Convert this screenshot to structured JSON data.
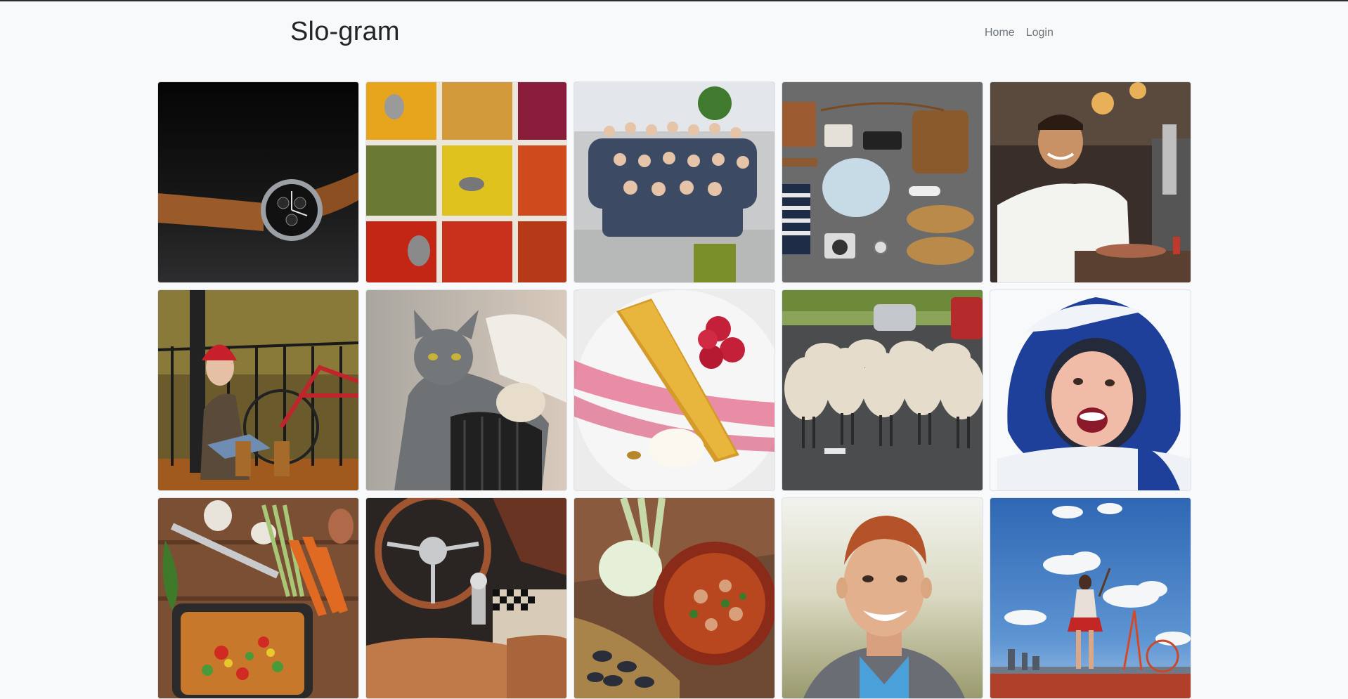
{
  "header": {
    "brand": "Slo-gram",
    "nav": [
      {
        "label": "Home"
      },
      {
        "label": "Login"
      }
    ]
  },
  "photos": [
    {
      "subject": "wristwatch"
    },
    {
      "subject": "spices"
    },
    {
      "subject": "group-photo"
    },
    {
      "subject": "flatlay-accessories"
    },
    {
      "subject": "chef"
    },
    {
      "subject": "woman-with-bicycle"
    },
    {
      "subject": "gray-cat"
    },
    {
      "subject": "tart-dessert"
    },
    {
      "subject": "sheep-on-road"
    },
    {
      "subject": "child-in-snow"
    },
    {
      "subject": "vegetables-cooking"
    },
    {
      "subject": "car-interior"
    },
    {
      "subject": "seafood-stew"
    },
    {
      "subject": "smiling-man"
    },
    {
      "subject": "child-in-field"
    }
  ]
}
